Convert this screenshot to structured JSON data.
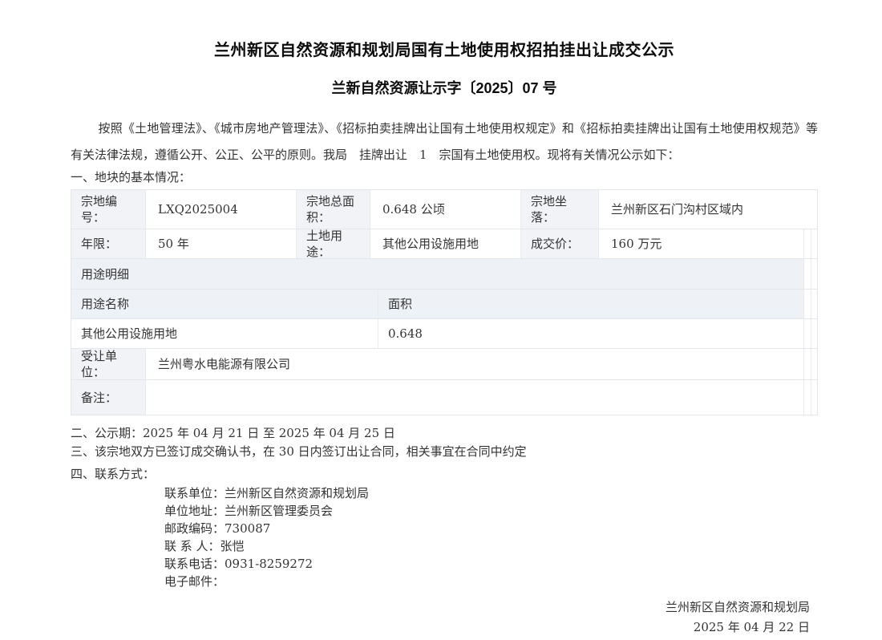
{
  "document": {
    "title": "兰州新区自然资源和规划局国有土地使用权招拍挂出让成交公示",
    "doc_number": "兰新自然资源让示字〔2025〕07 号",
    "intro": "按照《土地管理法》、《城市房地产管理法》、《招标拍卖挂牌出让国有土地使用权规定》和《招标拍卖挂牌出让国有土地使用权规范》等有关法律法规，遵循公开、公正、公平的原则。我局　挂牌出让　1　宗国有土地使用权。现将有关情况公示如下：",
    "section1_heading": "一、地块的基本情况："
  },
  "parcel": {
    "row1": {
      "label1": "宗地编号：",
      "value1": "LXQ2025004",
      "label2": "宗地总面积：",
      "value2": "0.648 公顷",
      "label3": "宗地坐落：",
      "value3": "兰州新区石门沟村区域内"
    },
    "row2": {
      "label1": "年限：",
      "value1": "50 年",
      "label2": "土地用途：",
      "value2": "其他公用设施用地",
      "label3": "成交价：",
      "value3": "160 万元"
    },
    "usage": {
      "header": "用途明细",
      "col_name": "用途名称",
      "col_area": "面积",
      "item_name": "其他公用设施用地",
      "item_area": "0.648"
    },
    "assignee_label": "受让单位：",
    "assignee_value": "兰州粤水电能源有限公司",
    "remark_label": "备注：",
    "remark_value": ""
  },
  "sections": {
    "publicity_period": "二、公示期：2025 年 04 月 21 日  至  2025 年 04 月 25 日",
    "confirmation": "三、该宗地双方已签订成交确认书，在 30 日内签订出让合同，相关事宜在合同中约定",
    "contact_heading": "四、联系方式："
  },
  "contact": {
    "unit_label": "联系单位：",
    "unit_value": "兰州新区自然资源和规划局",
    "address_label": "单位地址：",
    "address_value": "兰州新区管理委员会",
    "postcode_label": "邮政编码：",
    "postcode_value": "730087",
    "person_label": "联 系 人：",
    "person_value": "张恺",
    "phone_label": "联系电话：",
    "phone_value": "0931-8259272",
    "email_label": "电子邮件：",
    "email_value": ""
  },
  "footer": {
    "issuer": "兰州新区自然资源和规划局",
    "date": "2025 年 04 月 22 日"
  },
  "colors": {
    "label_cell_bg": "#f1f3f7",
    "shaded_row_bg": "#eef1f6",
    "table_border": "#e3e6ec",
    "body_text": "#333333",
    "title_text": "#0d0d0d",
    "page_bg": "#ffffff"
  }
}
